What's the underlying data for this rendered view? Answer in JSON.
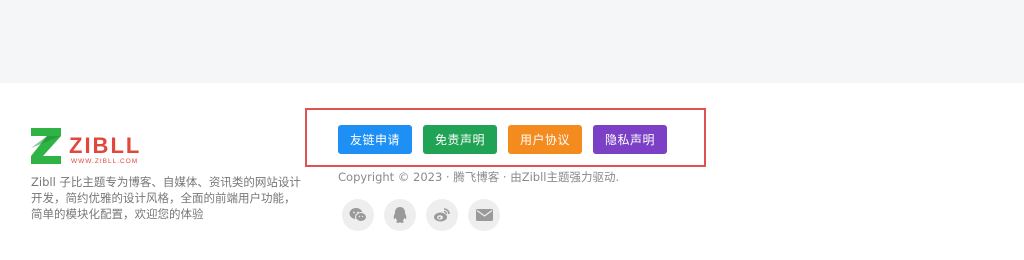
{
  "brand": {
    "logo_text": "ZIBLL",
    "logo_sub": "WWW.ZIBLL.COM",
    "description": "Zibll 子比主题专为博客、自媒体、资讯类的网站设计开发，简约优雅的设计风格，全面的前端用户功能，简单的模块化配置，欢迎您的体验"
  },
  "links": [
    {
      "label": "友链申请",
      "color": "#1e90f5"
    },
    {
      "label": "免责声明",
      "color": "#21a355"
    },
    {
      "label": "用户协议",
      "color": "#f48b1f"
    },
    {
      "label": "隐私声明",
      "color": "#7b40c6"
    }
  ],
  "copyright": "Copyright © 2023 · 腾飞博客 · 由Zibll主题强力驱动.",
  "social": [
    {
      "icon": "wechat-icon"
    },
    {
      "icon": "qq-icon"
    },
    {
      "icon": "weibo-icon"
    },
    {
      "icon": "mail-icon"
    }
  ],
  "colors": {
    "highlight_border": "#e05252",
    "logo_green": "#2fb344",
    "logo_red": "#e0483e"
  }
}
